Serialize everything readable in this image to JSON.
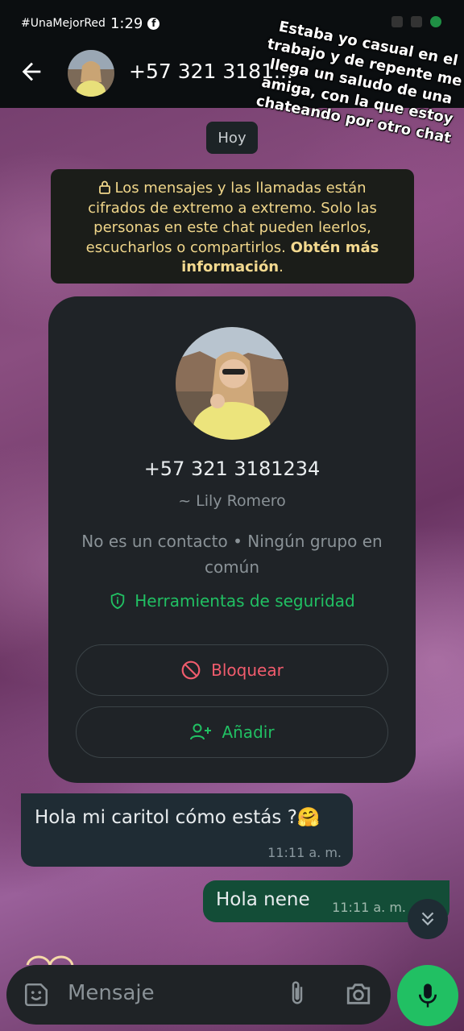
{
  "status_bar": {
    "carrier_tag": "#UnaMejorRed",
    "time": "1:29",
    "app_badge": "f"
  },
  "header": {
    "title": "+57 321 3181...",
    "back_icon": "arrow-left-icon",
    "avatar": "contact-avatar"
  },
  "overlay_caption": "Estaba yo casual en el trabajo y de repente me llega un saludo de una amiga, con la que estoy chateando por otro chat",
  "chat": {
    "date_chip": "Hoy",
    "encryption_notice": {
      "text": "Los mensajes y las llamadas están cifrados de extremo a extremo. Solo las personas en este chat pueden leerlos, escucharlos o compartirlos.",
      "link": "Obtén más información",
      "suffix": "."
    },
    "profile_card": {
      "phone": "+57 321 3181234",
      "name": "~ Lily Romero",
      "info": "No es un contacto • Ningún grupo en común",
      "security_link": "Herramientas de seguridad",
      "block_button": "Bloquear",
      "add_button": "Añadir"
    },
    "messages": [
      {
        "direction": "incoming",
        "text": "Hola mi caritol cómo estás ?🤗",
        "time": "11:11 a. m."
      },
      {
        "direction": "outgoing",
        "text": "Hola nene",
        "time": "11:11 a. m."
      }
    ]
  },
  "composer": {
    "placeholder": "Mensaje"
  },
  "colors": {
    "accent_green": "#21c063",
    "danger_red": "#f15c6d",
    "notice_yellow": "#f0d68a",
    "outgoing_bubble": "#134d37",
    "incoming_bubble": "#1f2c34"
  }
}
